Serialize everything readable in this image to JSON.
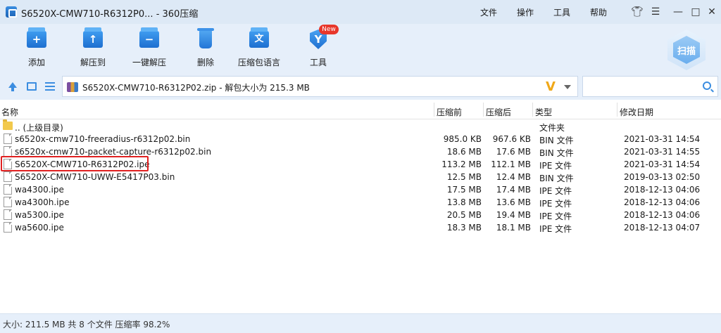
{
  "window": {
    "title": "S6520X-CMW710-R6312P0... - 360压缩",
    "menu": [
      "文件",
      "操作",
      "工具",
      "帮助"
    ]
  },
  "toolbar": {
    "tools": [
      {
        "label": "添加",
        "icon": "add-icon"
      },
      {
        "label": "解压到",
        "icon": "extract-to-icon"
      },
      {
        "label": "一键解压",
        "icon": "quick-extract-icon"
      },
      {
        "label": "删除",
        "icon": "delete-icon"
      },
      {
        "label": "压缩包语言",
        "icon": "language-icon",
        "glyph": "文"
      },
      {
        "label": "工具",
        "icon": "tools-icon",
        "glyph": "Y"
      }
    ],
    "new_badge": "New",
    "scan_label": "扫描"
  },
  "address": {
    "path": "S6520X-CMW710-R6312P02.zip - 解包大小为 215.3 MB",
    "search_placeholder": ""
  },
  "list": {
    "columns": [
      "名称",
      "压缩前",
      "压缩后",
      "类型",
      "修改日期"
    ],
    "rows": [
      {
        "name": ".. (上级目录)",
        "before": "",
        "after": "",
        "type": "文件夹",
        "date": "",
        "icon": "folder-icon"
      },
      {
        "name": "s6520x-cmw710-freeradius-r6312p02.bin",
        "before": "985.0 KB",
        "after": "967.6 KB",
        "type": "BIN 文件",
        "date": "2021-03-31 14:54",
        "icon": "file-icon"
      },
      {
        "name": "s6520x-cmw710-packet-capture-r6312p02.bin",
        "before": "18.6 MB",
        "after": "17.6 MB",
        "type": "BIN 文件",
        "date": "2021-03-31 14:55",
        "icon": "file-icon"
      },
      {
        "name": "S6520X-CMW710-R6312P02.ipe",
        "before": "113.2 MB",
        "after": "112.1 MB",
        "type": "IPE 文件",
        "date": "2021-03-31 14:54",
        "icon": "file-icon"
      },
      {
        "name": "S6520X-CMW710-UWW-E5417P03.bin",
        "before": "12.5 MB",
        "after": "12.4 MB",
        "type": "BIN 文件",
        "date": "2019-03-13 02:50",
        "icon": "file-icon"
      },
      {
        "name": "wa4300.ipe",
        "before": "17.5 MB",
        "after": "17.4 MB",
        "type": "IPE 文件",
        "date": "2018-12-13 04:06",
        "icon": "file-icon"
      },
      {
        "name": "wa4300h.ipe",
        "before": "13.8 MB",
        "after": "13.6 MB",
        "type": "IPE 文件",
        "date": "2018-12-13 04:06",
        "icon": "file-icon"
      },
      {
        "name": "wa5300.ipe",
        "before": "20.5 MB",
        "after": "19.4 MB",
        "type": "IPE 文件",
        "date": "2018-12-13 04:06",
        "icon": "file-icon"
      },
      {
        "name": "wa5600.ipe",
        "before": "18.3 MB",
        "after": "18.1 MB",
        "type": "IPE 文件",
        "date": "2018-12-13 04:07",
        "icon": "file-icon"
      }
    ]
  },
  "status": {
    "text": "大小: 211.5 MB 共 8 个文件 压缩率 98.2%"
  },
  "colors": {
    "accent": "#3b8de0",
    "highlight": "#e02020",
    "badge": "#e8372b"
  }
}
